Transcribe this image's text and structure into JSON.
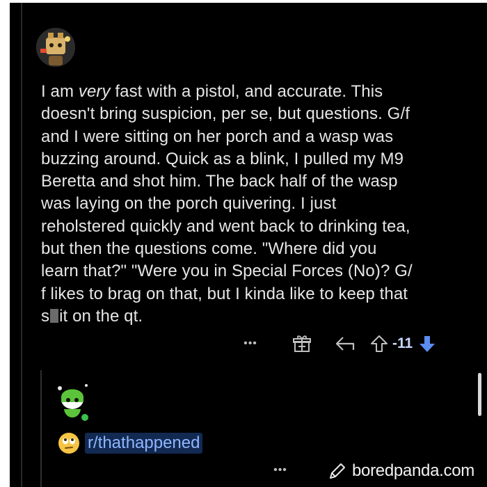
{
  "comment": {
    "lines": [
      {
        "before": "I am ",
        "emphasis": "very",
        "after": " fast with a pistol, and accurate. This"
      },
      "doesn't bring suspicion, per se, but questions. G/f",
      "and I were sitting on her porch and a wasp was",
      "buzzing around. Quick as a blink, I pulled my M9",
      "Beretta and shot him. The back half of the wasp",
      "was laying on the porch quivering. I just",
      "reholstered quickly and went back to drinking tea,",
      "but then the questions come. \"Where did you",
      "learn that?\" \"Were you in Special Forces (No)?  G/",
      "f likes to brag on that, but I kinda like to keep that",
      {
        "before": "s",
        "after": "it on the qt."
      }
    ],
    "actions": {
      "more_label": "•••",
      "vote_count": "-11"
    }
  },
  "reply": {
    "subreddit": "r/thathappened",
    "emoji": "eye-roll-emoji",
    "actions": {
      "more_label": "•••"
    }
  },
  "watermark": {
    "text": "boredpanda.com"
  },
  "colors": {
    "background": "#000000",
    "text": "#e6e6e6",
    "downvote": "#5b8def",
    "link": "#8fb6ff"
  }
}
